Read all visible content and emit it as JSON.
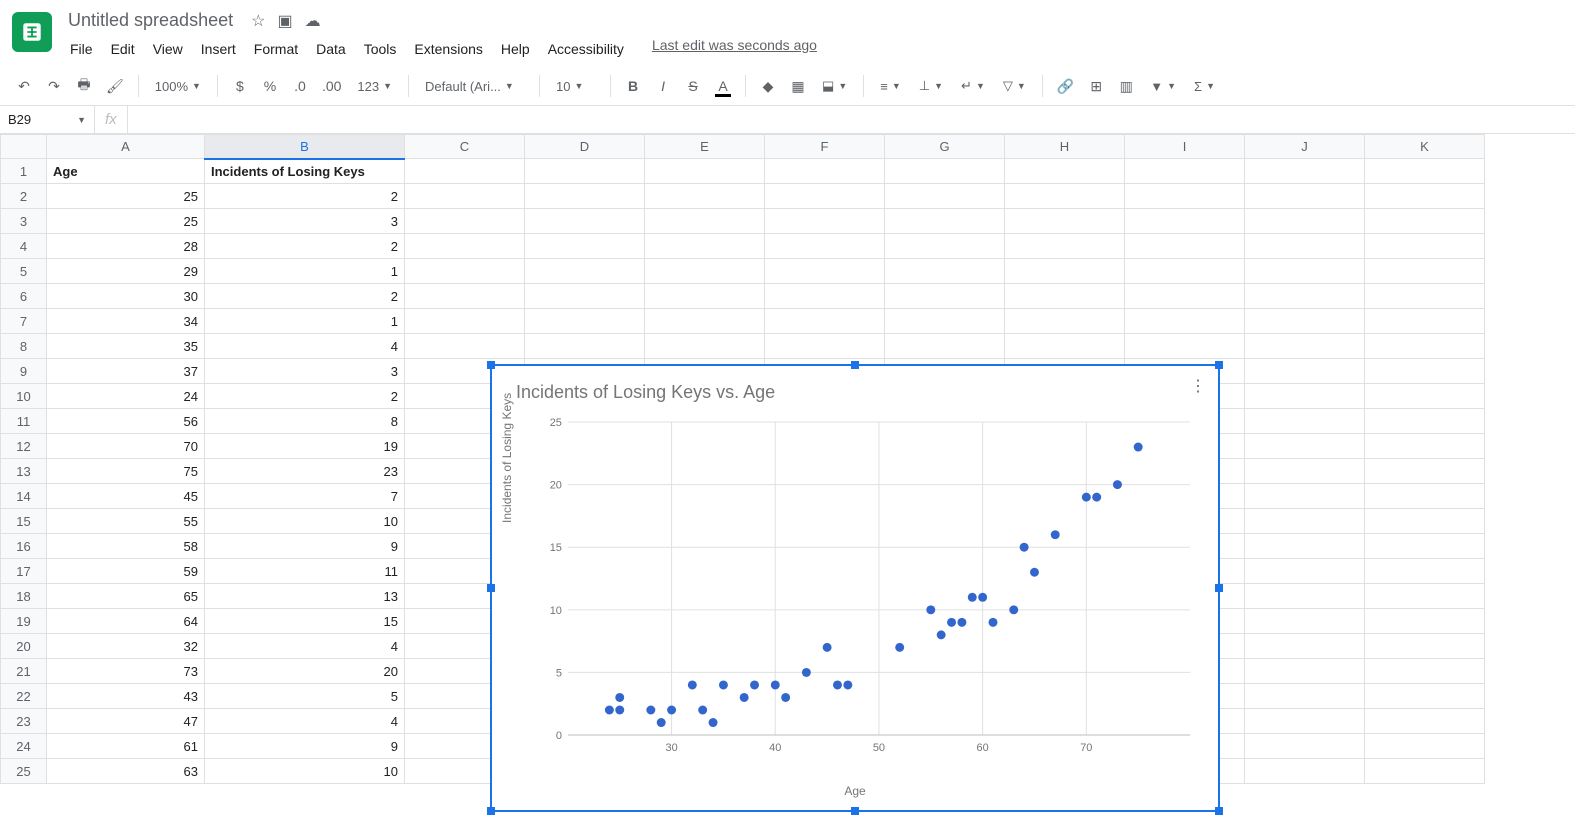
{
  "doc_title": "Untitled spreadsheet",
  "menus": {
    "file": "File",
    "edit": "Edit",
    "view": "View",
    "insert": "Insert",
    "format": "Format",
    "data": "Data",
    "tools": "Tools",
    "extensions": "Extensions",
    "help": "Help",
    "accessibility": "Accessibility"
  },
  "last_edit": "Last edit was seconds ago",
  "toolbar": {
    "zoom": "100%",
    "currency": "$",
    "percent": "%",
    "dec_dec": ".0",
    "inc_dec": ".00",
    "more_formats": "123",
    "font": "Default (Ari...",
    "font_size": "10",
    "bold": "B",
    "italic": "I",
    "strike": "S",
    "text_color": "A"
  },
  "namebox": "B29",
  "fx_label": "fx",
  "columns": [
    "A",
    "B",
    "C",
    "D",
    "E",
    "F",
    "G",
    "H",
    "I",
    "J",
    "K"
  ],
  "headers": {
    "A": "Age",
    "B": "Incidents of Losing Keys"
  },
  "rows": [
    {
      "r": 1
    },
    {
      "r": 2,
      "A": 25,
      "B": 2
    },
    {
      "r": 3,
      "A": 25,
      "B": 3
    },
    {
      "r": 4,
      "A": 28,
      "B": 2
    },
    {
      "r": 5,
      "A": 29,
      "B": 1
    },
    {
      "r": 6,
      "A": 30,
      "B": 2
    },
    {
      "r": 7,
      "A": 34,
      "B": 1
    },
    {
      "r": 8,
      "A": 35,
      "B": 4
    },
    {
      "r": 9,
      "A": 37,
      "B": 3
    },
    {
      "r": 10,
      "A": 24,
      "B": 2
    },
    {
      "r": 11,
      "A": 56,
      "B": 8
    },
    {
      "r": 12,
      "A": 70,
      "B": 19
    },
    {
      "r": 13,
      "A": 75,
      "B": 23
    },
    {
      "r": 14,
      "A": 45,
      "B": 7
    },
    {
      "r": 15,
      "A": 55,
      "B": 10
    },
    {
      "r": 16,
      "A": 58,
      "B": 9
    },
    {
      "r": 17,
      "A": 59,
      "B": 11
    },
    {
      "r": 18,
      "A": 65,
      "B": 13
    },
    {
      "r": 19,
      "A": 64,
      "B": 15
    },
    {
      "r": 20,
      "A": 32,
      "B": 4
    },
    {
      "r": 21,
      "A": 73,
      "B": 20
    },
    {
      "r": 22,
      "A": 43,
      "B": 5
    },
    {
      "r": 23,
      "A": 47,
      "B": 4
    },
    {
      "r": 24,
      "A": 61,
      "B": 9
    },
    {
      "r": 25,
      "A": 63,
      "B": 10
    }
  ],
  "chart_data": {
    "type": "scatter",
    "title": "Incidents of Losing Keys vs. Age",
    "xlabel": "Age",
    "ylabel": "Incidents of Losing Keys",
    "xlim": [
      20,
      80
    ],
    "ylim": [
      0,
      25
    ],
    "xticks": [
      30,
      40,
      50,
      60,
      70
    ],
    "yticks": [
      0,
      5,
      10,
      15,
      20,
      25
    ],
    "series": [
      {
        "name": "Incidents of Losing Keys",
        "points": [
          [
            25,
            2
          ],
          [
            25,
            3
          ],
          [
            28,
            2
          ],
          [
            29,
            1
          ],
          [
            30,
            2
          ],
          [
            34,
            1
          ],
          [
            35,
            4
          ],
          [
            37,
            3
          ],
          [
            24,
            2
          ],
          [
            56,
            8
          ],
          [
            70,
            19
          ],
          [
            75,
            23
          ],
          [
            45,
            7
          ],
          [
            55,
            10
          ],
          [
            58,
            9
          ],
          [
            59,
            11
          ],
          [
            65,
            13
          ],
          [
            64,
            15
          ],
          [
            32,
            4
          ],
          [
            73,
            20
          ],
          [
            43,
            5
          ],
          [
            47,
            4
          ],
          [
            61,
            9
          ],
          [
            63,
            10
          ],
          [
            38,
            4
          ],
          [
            40,
            4
          ],
          [
            41,
            3
          ],
          [
            33,
            2
          ],
          [
            52,
            7
          ],
          [
            57,
            9
          ],
          [
            60,
            11
          ],
          [
            67,
            16
          ],
          [
            71,
            19
          ],
          [
            46,
            4
          ]
        ]
      }
    ]
  }
}
